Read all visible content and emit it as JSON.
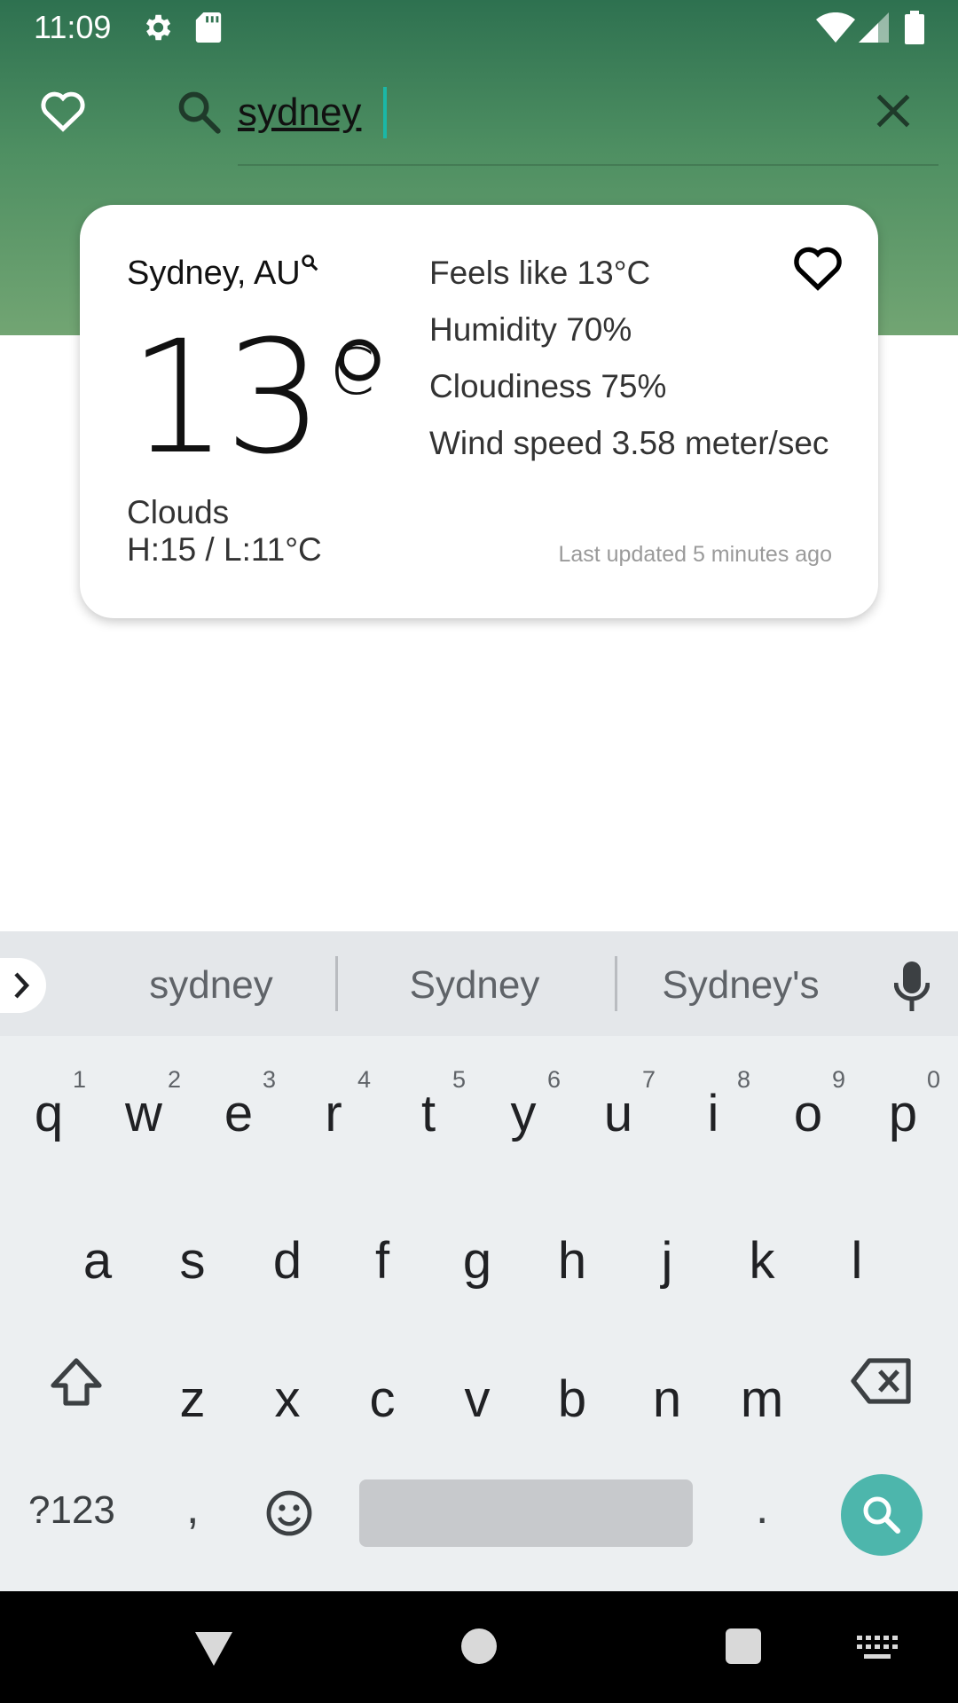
{
  "status_bar": {
    "time": "11:09"
  },
  "search": {
    "query": "sydney"
  },
  "weather": {
    "city": "Sydney, AU",
    "temperature": "13°",
    "unit": "C",
    "description": "Clouds",
    "high_low": "H:15 / L:11°C",
    "feels_like": "Feels like 13°C",
    "humidity": "Humidity 70%",
    "cloudiness": "Cloudiness 75%",
    "wind_speed": "Wind speed 3.58 meter/sec",
    "last_updated": "Last updated 5 minutes ago"
  },
  "keyboard": {
    "suggestions": [
      "sydney",
      "Sydney",
      "Sydney's"
    ],
    "row1": [
      {
        "key": "q",
        "hint": "1"
      },
      {
        "key": "w",
        "hint": "2"
      },
      {
        "key": "e",
        "hint": "3"
      },
      {
        "key": "r",
        "hint": "4"
      },
      {
        "key": "t",
        "hint": "5"
      },
      {
        "key": "y",
        "hint": "6"
      },
      {
        "key": "u",
        "hint": "7"
      },
      {
        "key": "i",
        "hint": "8"
      },
      {
        "key": "o",
        "hint": "9"
      },
      {
        "key": "p",
        "hint": "0"
      }
    ],
    "row2": [
      "a",
      "s",
      "d",
      "f",
      "g",
      "h",
      "j",
      "k",
      "l"
    ],
    "row3": [
      "z",
      "x",
      "c",
      "v",
      "b",
      "n",
      "m"
    ],
    "symbols_label": "?123",
    "comma": ",",
    "period": "."
  },
  "colors": {
    "header_top": "#2e7150",
    "header_bottom": "#72a573",
    "accent": "#4db6ac",
    "caret": "#1bb7a6"
  }
}
